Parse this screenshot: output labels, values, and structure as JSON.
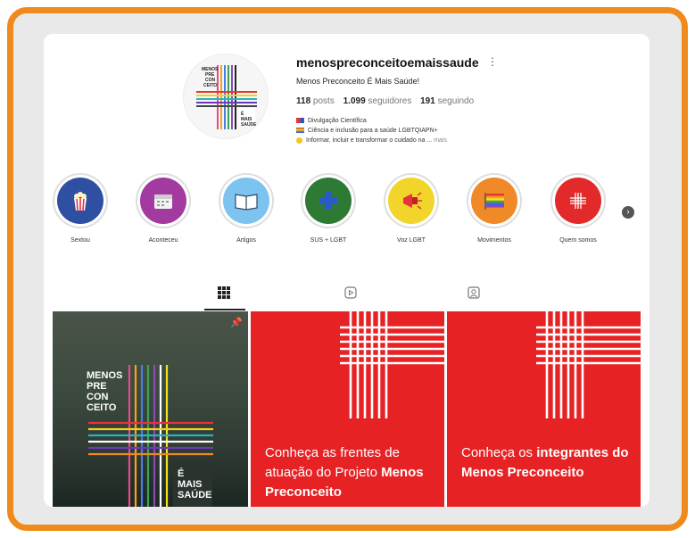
{
  "profile": {
    "username": "menospreconceitoemaissaude",
    "display_name": "Menos Preconceito É Mais Saúde!",
    "posts_count": "118",
    "posts_label": "posts",
    "followers_count": "1.099",
    "followers_label": "seguidores",
    "following_count": "191",
    "following_label": "seguindo",
    "bio_line1": "Divulgação Científica",
    "bio_line2": "Ciência e inclusão para a saúde LGBTQIAPN+",
    "bio_line3": "Informar, incluir e transformar o cuidado na ...",
    "bio_more": "mais",
    "avatar_text_top": "MENOS PRE CON CEITO",
    "avatar_text_bottom": "É MAIS SAÚDE"
  },
  "highlights": [
    {
      "label": "Sextou",
      "color": "#2f4fa3",
      "icon": "popcorn-icon"
    },
    {
      "label": "Aconteceu",
      "color": "#a23aa0",
      "icon": "calendar-icon"
    },
    {
      "label": "Artigos",
      "color": "#7cc3ef",
      "icon": "book-icon"
    },
    {
      "label": "SUS + LGBT",
      "color": "#2e7a35",
      "icon": "cross-icon"
    },
    {
      "label": "Voz LGBT",
      "color": "#f2d52a",
      "icon": "megaphone-icon"
    },
    {
      "label": "Movimentos",
      "color": "#f08a28",
      "icon": "rainbow-flag-icon"
    },
    {
      "label": "Quem somos",
      "color": "#e22a2a",
      "icon": "logo-icon"
    }
  ],
  "tabs": [
    {
      "name": "posts",
      "icon": "grid-icon",
      "active": true
    },
    {
      "name": "reels",
      "icon": "reels-icon",
      "active": false
    },
    {
      "name": "tagged",
      "icon": "tagged-icon",
      "active": false
    }
  ],
  "posts": {
    "post1_logo_top": "MENOS\nPRE\nCON\nCEITO",
    "post1_logo_bottom": "É\nMAIS\nSAÚDE",
    "post2_caption_plain": "Conheça as frentes de atuação do Projeto ",
    "post2_caption_bold": "Menos Preconceito",
    "post3_caption_plain": "Conheça os ",
    "post3_caption_bold": "integrantes do Menos Preconceito"
  },
  "colors": {
    "frame_orange": "#f08a1c",
    "post_red": "#e62224"
  }
}
